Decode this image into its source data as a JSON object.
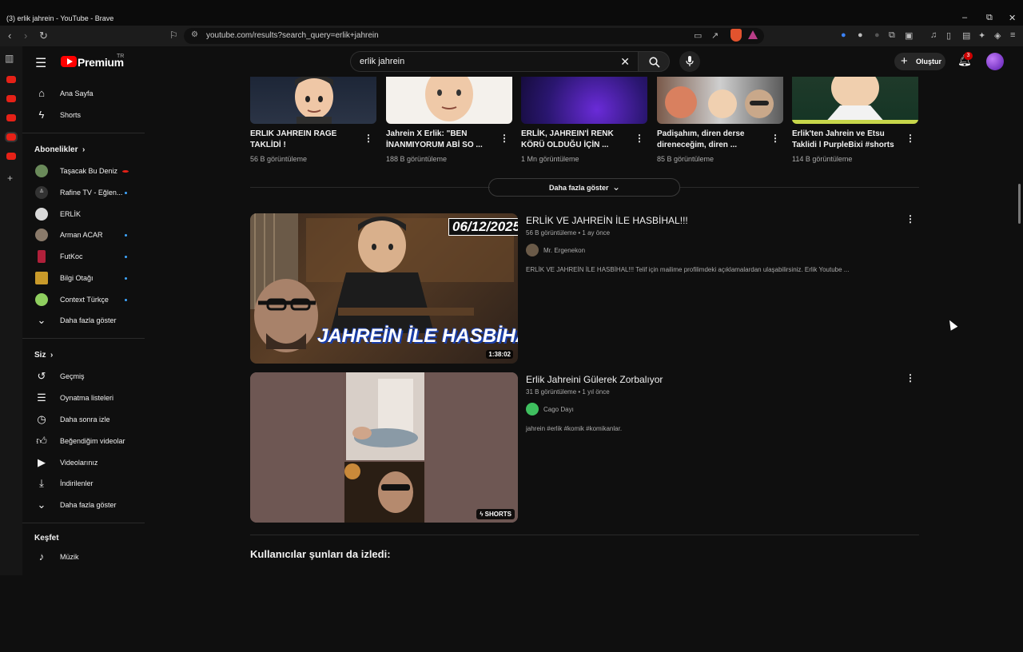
{
  "browser": {
    "window_title": "(3) erlik jahrein - YouTube - Brave",
    "url": "youtube.com/results?search_query=erlik+jahrein",
    "minimize": "–",
    "restore": "⧉",
    "close": "✕"
  },
  "header": {
    "logo_text": "Premium",
    "logo_tr": "TR",
    "search_value": "erlik jahrein",
    "create_label": "Oluştur",
    "notification_count": "3"
  },
  "sidebar": {
    "main_items": [
      {
        "label": "Ana Sayfa",
        "icon": "home-icon"
      },
      {
        "label": "Shorts",
        "icon": "shorts-icon"
      }
    ],
    "subscriptions_heading": "Abonelikler",
    "subscriptions": [
      {
        "label": "Taşacak Bu Deniz",
        "color": "#6a8a5a"
      },
      {
        "label": "Rafine TV - Eğlen...",
        "color": "#333333"
      },
      {
        "label": "ERLİK",
        "color": "#d9d9d9"
      },
      {
        "label": "Arman ACAR",
        "color": "#8a7a6a"
      },
      {
        "label": "FutKoc",
        "color": "#b0203a"
      },
      {
        "label": "Bilgi Otağı",
        "color": "#c99a2a"
      },
      {
        "label": "Context Türkçe",
        "color": "#8fcf5f"
      }
    ],
    "show_more_subs": "Daha fazla göster",
    "you_heading": "Siz",
    "you_items": [
      {
        "label": "Geçmiş",
        "icon": "history-icon"
      },
      {
        "label": "Oynatma listeleri",
        "icon": "playlist-icon"
      },
      {
        "label": "Daha sonra izle",
        "icon": "watch-later-icon"
      },
      {
        "label": "Beğendiğim videolar",
        "icon": "like-icon"
      },
      {
        "label": "Videolarınız",
        "icon": "your-videos-icon"
      },
      {
        "label": "İndirilenler",
        "icon": "download-icon"
      }
    ],
    "show_more_you": "Daha fazla göster",
    "explore_heading": "Keşfet",
    "explore_items": [
      {
        "label": "Müzik",
        "icon": "music-icon"
      }
    ]
  },
  "shorts": [
    {
      "title": "ERLIK JAHREIN RAGE TAKLİDİ !",
      "views": "56 B görüntüleme"
    },
    {
      "title": "Jahrein X Erlik: \"BEN İNANMIYORUM ABİ SO ...",
      "views": "188 B görüntüleme"
    },
    {
      "title": "ERLİK, JAHREIN'İ RENK KÖRÜ OLDUĞU İÇİN ...",
      "views": "1 Mn görüntüleme"
    },
    {
      "title": "Padişahım, diren derse direneceğim, diren ...",
      "views": "85 B görüntüleme"
    },
    {
      "title": "Erlik'ten Jahrein ve Etsu Taklidi l PurpleBixi #shorts",
      "views": "114 B görüntüleme"
    }
  ],
  "shorts_show_more": "Daha fazla göster",
  "videos": [
    {
      "title": "ERLİK VE JAHREİN İLE HASBİHAL!!!",
      "meta": "56 B görüntüleme • 1 ay önce",
      "channel": "Mr. Ergenekon",
      "description": "ERLİK VE JAHREİN İLE HASBİHAL!!! Telif için mailime profilimdeki açıklamalardan ulaşabilirsiniz. Erlik Youtube ...",
      "duration": "1:38:02",
      "thumb_text": "JAHREİN İLE HASBİHAL!!",
      "thumb_date": "06/12/2025"
    },
    {
      "title": "Erlik Jahreini Gülerek Zorbalıyor",
      "meta": "31 B görüntüleme • 1 yıl önce",
      "channel": "Cago Dayı",
      "description": "jahrein #erlik #komik #komikanlar.",
      "badge": "SHORTS"
    }
  ],
  "section_heading": "Kullanıcılar şunları da izledi:"
}
